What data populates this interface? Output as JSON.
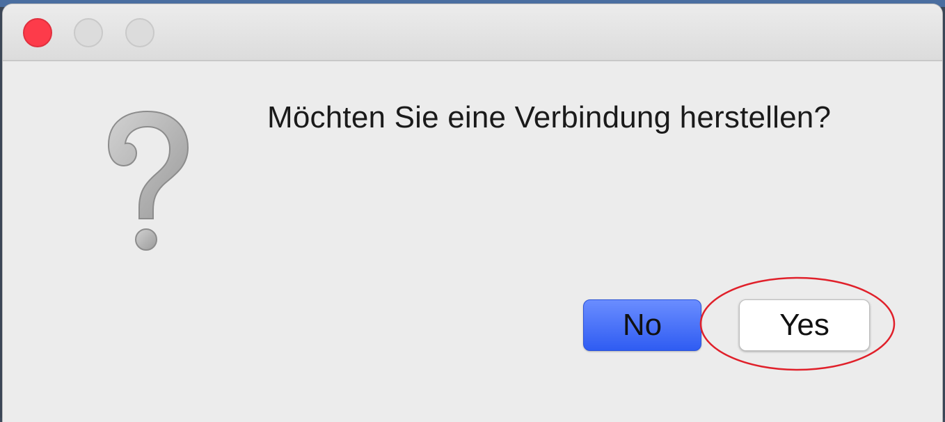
{
  "dialog": {
    "message": "Möchten Sie eine Verbindung herstellen?",
    "icon": "question-mark-icon",
    "buttons": {
      "no_label": "No",
      "yes_label": "Yes"
    },
    "titlebar": {
      "controls": [
        "close-button",
        "minimize-button",
        "maximize-button"
      ]
    }
  },
  "colors": {
    "close_button": "#fd3b4a",
    "default_button": "#2f5cf2",
    "annotation_circle": "#e0202a"
  }
}
